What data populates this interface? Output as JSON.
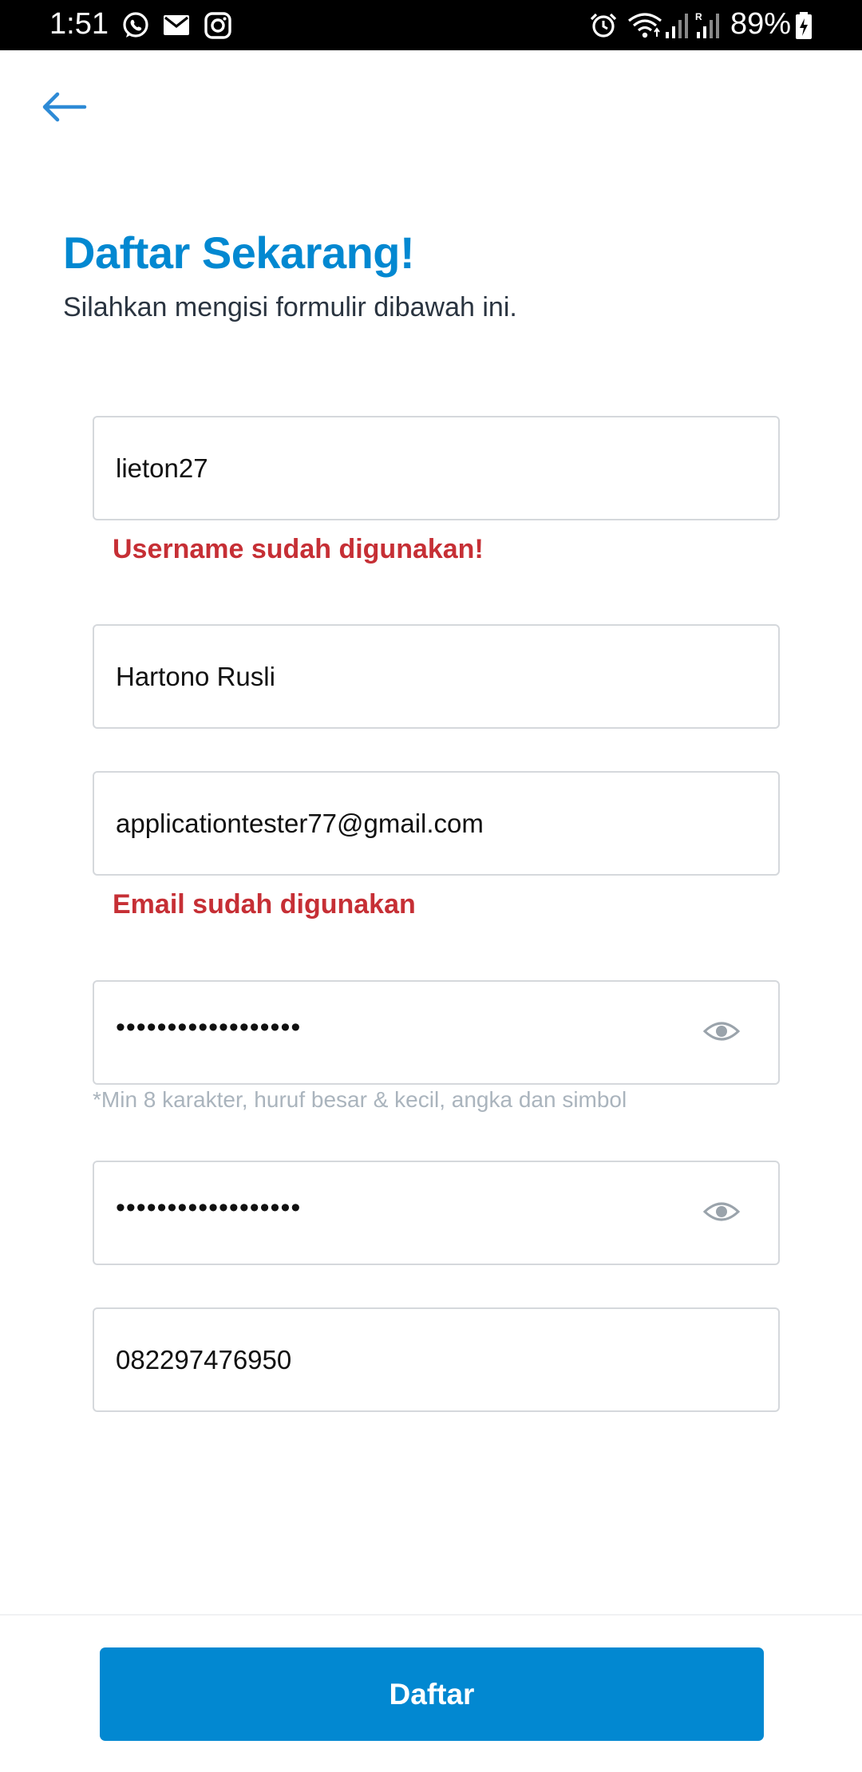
{
  "status_bar": {
    "time": "1:51",
    "battery": "89%",
    "icons": [
      "whatsapp-icon",
      "mail-icon",
      "instagram-icon",
      "alarm-icon",
      "wifi-icon",
      "signal-icon",
      "signal-roaming-icon",
      "battery-charging-icon"
    ],
    "roaming_label": "R"
  },
  "header": {
    "back_icon": "arrow-left-icon",
    "title": "Daftar Sekarang!",
    "subtitle": "Silahkan mengisi formulir dibawah ini."
  },
  "form": {
    "username": {
      "value": "lieton27",
      "error": "Username sudah digunakan!"
    },
    "fullname": {
      "value": "Hartono Rusli"
    },
    "email": {
      "value": "applicationtester77@gmail.com",
      "error": "Email sudah digunakan"
    },
    "password": {
      "value": "••••••••••••••••••",
      "hint": "*Min 8 karakter, huruf besar & kecil, angka dan simbol",
      "toggle_icon": "eye-icon"
    },
    "confirm_password": {
      "value": "••••••••••••••••••",
      "toggle_icon": "eye-icon"
    },
    "phone": {
      "value": "082297476950"
    }
  },
  "submit": {
    "label": "Daftar"
  },
  "colors": {
    "accent": "#0288d1",
    "error": "#c62f35",
    "hint": "#aab4bd",
    "border": "#d5d8dc"
  }
}
